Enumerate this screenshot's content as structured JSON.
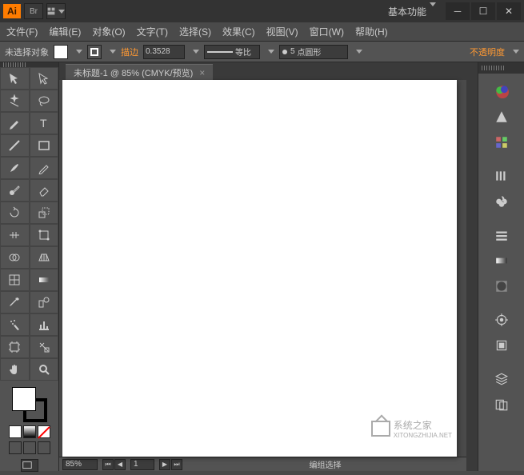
{
  "title_area": {
    "workspace_label": "基本功能"
  },
  "menus": {
    "file": "文件(F)",
    "edit": "编辑(E)",
    "object": "对象(O)",
    "type": "文字(T)",
    "select": "选择(S)",
    "effect": "效果(C)",
    "view": "视图(V)",
    "window": "窗口(W)",
    "help": "帮助(H)"
  },
  "control_bar": {
    "selection_status": "未选择对象",
    "stroke_label": "描边",
    "stroke_weight": "0.3528",
    "profile_label": "等比",
    "brush_points": "5",
    "brush_label": "点圆形",
    "opacity_label": "不透明度"
  },
  "document": {
    "tab_title": "未标题-1 @ 85% (CMYK/预览)"
  },
  "status": {
    "zoom": "85%",
    "page": "1",
    "mode_text": "编组选择"
  },
  "watermark": {
    "line1": "系统之家",
    "line2": "XITONGZHIJIA.NET"
  },
  "tool_names": [
    "selection-tool",
    "direct-selection-tool",
    "magic-wand-tool",
    "lasso-tool",
    "pen-tool",
    "type-tool",
    "line-tool",
    "rectangle-tool",
    "paintbrush-tool",
    "pencil-tool",
    "blob-brush-tool",
    "eraser-tool",
    "rotate-tool",
    "scale-tool",
    "width-tool",
    "free-transform-tool",
    "shape-builder-tool",
    "perspective-grid-tool",
    "mesh-tool",
    "gradient-tool",
    "eyedropper-tool",
    "blend-tool",
    "symbol-sprayer-tool",
    "graph-tool",
    "artboard-tool",
    "slice-tool",
    "hand-tool",
    "zoom-tool"
  ],
  "right_panel_names": [
    "color-panel",
    "color-guide-panel",
    "swatches-panel",
    "brushes-panel",
    "symbols-panel",
    "stroke-panel",
    "gradient-panel",
    "transparency-panel",
    "appearance-panel",
    "graphic-styles-panel",
    "layers-panel",
    "artboards-panel"
  ]
}
